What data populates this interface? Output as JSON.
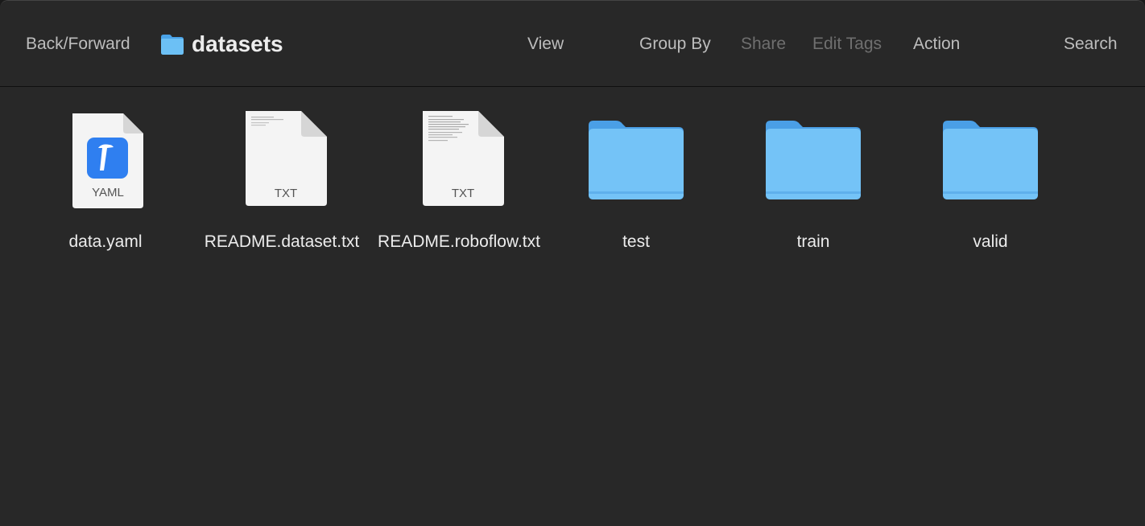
{
  "toolbar": {
    "back_forward": "Back/Forward",
    "title": "datasets",
    "view": "View",
    "group_by": "Group By",
    "share": "Share",
    "edit_tags": "Edit Tags",
    "action": "Action",
    "search": "Search"
  },
  "files": [
    {
      "name": "data.yaml",
      "type_label": "YAML",
      "icon": "yaml-file-icon"
    },
    {
      "name": "README.dataset.txt",
      "type_label": "TXT",
      "icon": "text-file-icon"
    },
    {
      "name": "README.roboflow.txt",
      "type_label": "TXT",
      "icon": "text-file-icon"
    },
    {
      "name": "test",
      "icon": "folder-icon"
    },
    {
      "name": "train",
      "icon": "folder-icon"
    },
    {
      "name": "valid",
      "icon": "folder-icon"
    }
  ],
  "colors": {
    "window_bg": "#282828",
    "folder_blue": "#6cbcf2",
    "yaml_badge": "#2f7ff0"
  }
}
